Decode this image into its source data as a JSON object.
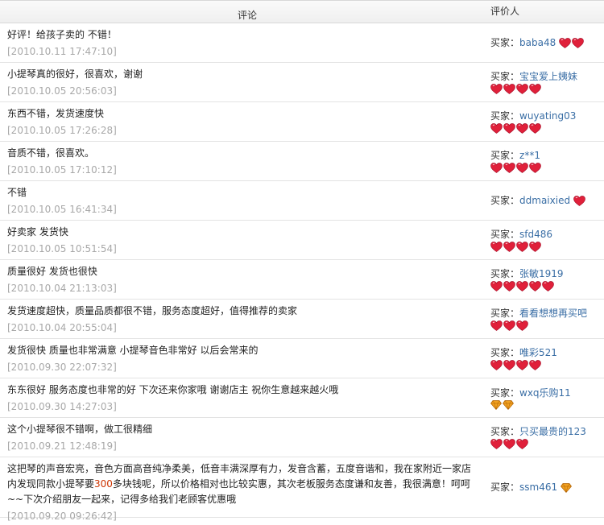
{
  "header": {
    "comment": "评论",
    "reviewer": "评价人"
  },
  "buyer_label": "买家：",
  "rows": [
    {
      "comment": "好评！给孩子卖的 不错！",
      "date": "[2010.10.11 17:47:10]",
      "buyer": "baba48",
      "icon": "heart",
      "count": 2,
      "inline": true
    },
    {
      "comment": "小提琴真的很好，很喜欢，谢谢",
      "date": "[2010.10.05 20:56:03]",
      "buyer": "宝宝爱上姨妹",
      "icon": "heart",
      "count": 4,
      "inline": false
    },
    {
      "comment": "东西不错，发货速度快",
      "date": "[2010.10.05 17:26:28]",
      "buyer": "wuyating03",
      "icon": "heart",
      "count": 4,
      "inline": false
    },
    {
      "comment": "音质不错，很喜欢。",
      "date": "[2010.10.05 17:10:12]",
      "buyer": "z**1",
      "icon": "heart",
      "count": 4,
      "inline": false
    },
    {
      "comment": "不错",
      "date": "[2010.10.05 16:41:34]",
      "buyer": "ddmaixied",
      "icon": "heart",
      "count": 1,
      "inline": true
    },
    {
      "comment": "好卖家 发货快",
      "date": "[2010.10.05 10:51:54]",
      "buyer": "sfd486",
      "icon": "heart",
      "count": 4,
      "inline": false
    },
    {
      "comment": "质量很好 发货也很快",
      "date": "[2010.10.04 21:13:03]",
      "buyer": "张敏1919",
      "icon": "heart",
      "count": 5,
      "inline": false
    },
    {
      "comment": "发货速度超快，质量品质都很不错，服务态度超好，值得推荐的卖家",
      "date": "[2010.10.04 20:55:04]",
      "buyer": "看看想想再买吧",
      "icon": "heart",
      "count": 3,
      "inline": false
    },
    {
      "comment": "发货很快 质量也非常满意 小提琴音色非常好 以后会常来的",
      "date": "[2010.09.30 22:07:32]",
      "buyer": "唯彩521",
      "icon": "heart",
      "count": 4,
      "inline": false
    },
    {
      "comment": "东东很好 服务态度也非常的好 下次还来你家哦 谢谢店主 祝你生意越来越火哦",
      "date": "[2010.09.30 14:27:03]",
      "buyer": "wxq乐购11",
      "icon": "diamond",
      "count": 2,
      "inline": false
    },
    {
      "comment": "这个小提琴很不错啊，做工很精细",
      "date": "[2010.09.21 12:48:19]",
      "buyer": "只买最贵的123",
      "icon": "heart",
      "count": 3,
      "inline": false
    }
  ],
  "last_row": {
    "comment_before": "这把琴的声音宏亮，音色方面高音纯净柔美，低音丰满深厚有力，发音含蓄，五度音谐和，我在家附近一家店内发现同款小提琴要",
    "comment_highlight": "300",
    "comment_after": "多块钱呢，所以价格相对也比较实惠，其次老板服务态度谦和友善，我很满意！呵呵~~下次介绍朋友一起来，记得多给我们老顾客优惠哦",
    "date": "[2010.09.20 09:26:42]",
    "buyer": "ssm461",
    "icon": "diamond",
    "count": 1
  },
  "colors": {
    "heart": "#e0203a",
    "diamond": "#f0a020",
    "link": "#3a6ea5",
    "date": "#a8a8a8"
  }
}
